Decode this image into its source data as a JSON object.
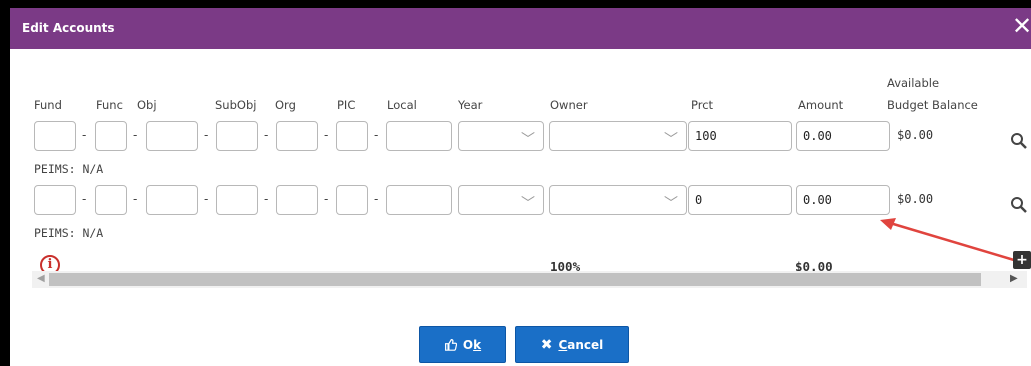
{
  "dialog": {
    "title": "Edit Accounts",
    "close_glyph": "✕"
  },
  "headers": {
    "fund": "Fund",
    "func": "Func",
    "obj": "Obj",
    "subobj": "SubObj",
    "org": "Org",
    "pic": "PIC",
    "local": "Local",
    "year": "Year",
    "owner": "Owner",
    "prct": "Prct",
    "amount": "Amount",
    "avail_line1": "Available",
    "avail_line2": "Budget Balance"
  },
  "rows": [
    {
      "prct": "100",
      "amount": "0.00",
      "balance": "$0.00",
      "peims": "PEIMS: N/A"
    },
    {
      "prct": "0",
      "amount": "0.00",
      "balance": "$0.00",
      "peims": "PEIMS: N/A"
    }
  ],
  "totals": {
    "prct": "100%",
    "amount": "$0.00"
  },
  "buttons": {
    "ok_icon": "thumbs-up-icon",
    "ok_prefix": "O",
    "ok_underlined": "k",
    "cancel_icon": "x-icon",
    "cancel_underlined": "C",
    "cancel_rest": "ancel"
  },
  "icons": {
    "info": "info-icon",
    "search": "search-icon",
    "add": "plus-icon"
  },
  "colors": {
    "titlebar": "#7b3a86",
    "primary_button": "#1a6fc7",
    "annotation_arrow": "#e0443e"
  }
}
